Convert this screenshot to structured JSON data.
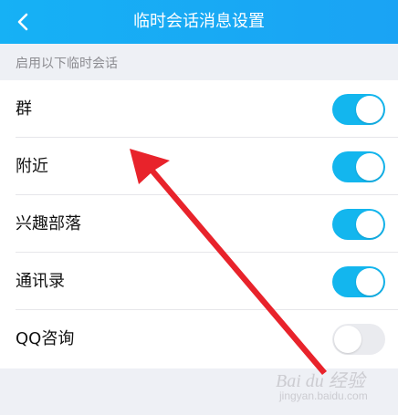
{
  "header": {
    "title": "临时会话消息设置",
    "back_icon": "chevron-left-icon"
  },
  "section": {
    "label": "启用以下临时会话"
  },
  "rows": [
    {
      "label": "群",
      "enabled": true
    },
    {
      "label": "附近",
      "enabled": true
    },
    {
      "label": "兴趣部落",
      "enabled": true
    },
    {
      "label": "通讯录",
      "enabled": true
    },
    {
      "label": "QQ咨询",
      "enabled": false
    }
  ],
  "watermark": {
    "text": "Bai du 经验",
    "url": "jingyan.baidu.com"
  },
  "colors": {
    "header": "#16b1f5",
    "toggle_on": "#13b6ee",
    "toggle_off": "#eaebef",
    "arrow": "#e8232b"
  }
}
